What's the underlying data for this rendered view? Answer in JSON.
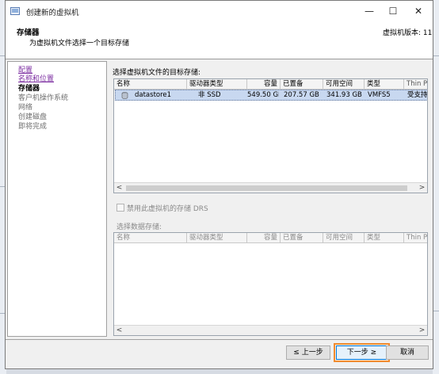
{
  "window": {
    "title": "创建新的虚拟机",
    "minimize_glyph": "—",
    "maximize_glyph": "☐",
    "close_glyph": "✕"
  },
  "header": {
    "title": "存储器",
    "subtitle": "为虚拟机文件选择一个目标存储",
    "version_label": "虚拟机版本: 11"
  },
  "nav": {
    "items": [
      {
        "label": "配置",
        "state": "link"
      },
      {
        "label": "名称和位置",
        "state": "link"
      },
      {
        "label": "存储器",
        "state": "current"
      },
      {
        "label": "客户机操作系统",
        "state": "pending"
      },
      {
        "label": "网络",
        "state": "pending"
      },
      {
        "label": "创建磁盘",
        "state": "pending"
      },
      {
        "label": "即将完成",
        "state": "pending"
      }
    ]
  },
  "target_storage": {
    "label": "选择虚拟机文件的目标存储:",
    "columns": [
      "名称",
      "驱动器类型",
      "容量",
      "已置备",
      "可用空间",
      "类型",
      "Thin Provi"
    ],
    "rows": [
      {
        "name": "datastore1",
        "drive_type": "非 SSD",
        "capacity": "549.50 GB",
        "provisioned": "207.57 GB",
        "free": "341.93 GB",
        "type": "VMFS5",
        "thin": "受支持"
      }
    ]
  },
  "drs": {
    "checkbox_label": "禁用此虚拟机的存储 DRS",
    "checked": false
  },
  "datastore_select": {
    "label": "选择数据存储:",
    "columns": [
      "名称",
      "驱动器类型",
      "容量",
      "已置备",
      "可用空间",
      "类型",
      "Thin Provi"
    ]
  },
  "footer": {
    "back_label": "≤ 上一步",
    "next_label": "下一步 ≥",
    "cancel_label": "取消"
  },
  "colors": {
    "highlight_outline": "#f28b2e",
    "selected_row": "#c8d8f0",
    "link": "#7b2ca0"
  }
}
